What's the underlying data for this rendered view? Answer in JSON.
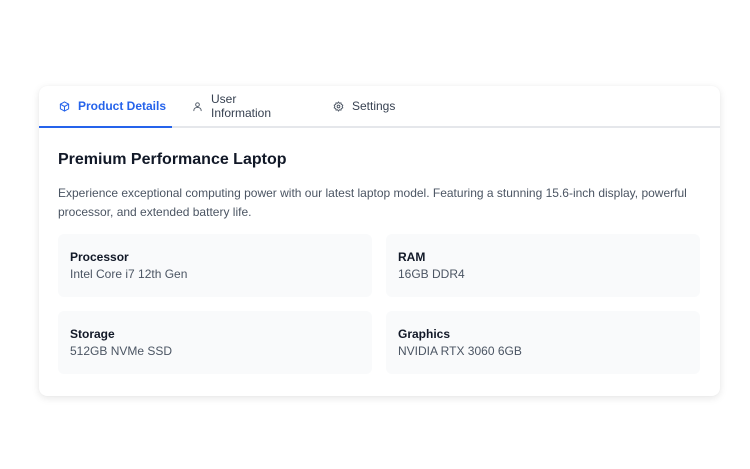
{
  "tabs": [
    {
      "label": "Product Details",
      "icon": "cube-icon",
      "active": true
    },
    {
      "label": "User Information",
      "icon": "user-icon",
      "active": false
    },
    {
      "label": "Settings",
      "icon": "gear-icon",
      "active": false
    }
  ],
  "product": {
    "title": "Premium Performance Laptop",
    "description": "Experience exceptional computing power with our latest laptop model. Featuring a stunning 15.6-inch display, powerful processor, and extended battery life."
  },
  "specs": [
    {
      "label": "Processor",
      "value": "Intel Core i7 12th Gen"
    },
    {
      "label": "RAM",
      "value": "16GB DDR4"
    },
    {
      "label": "Storage",
      "value": "512GB NVMe SSD"
    },
    {
      "label": "Graphics",
      "value": "NVIDIA RTX 3060 6GB"
    }
  ],
  "colors": {
    "accent": "#2563eb",
    "spec_background": "#f9fafb",
    "text_muted": "#4b5563"
  }
}
